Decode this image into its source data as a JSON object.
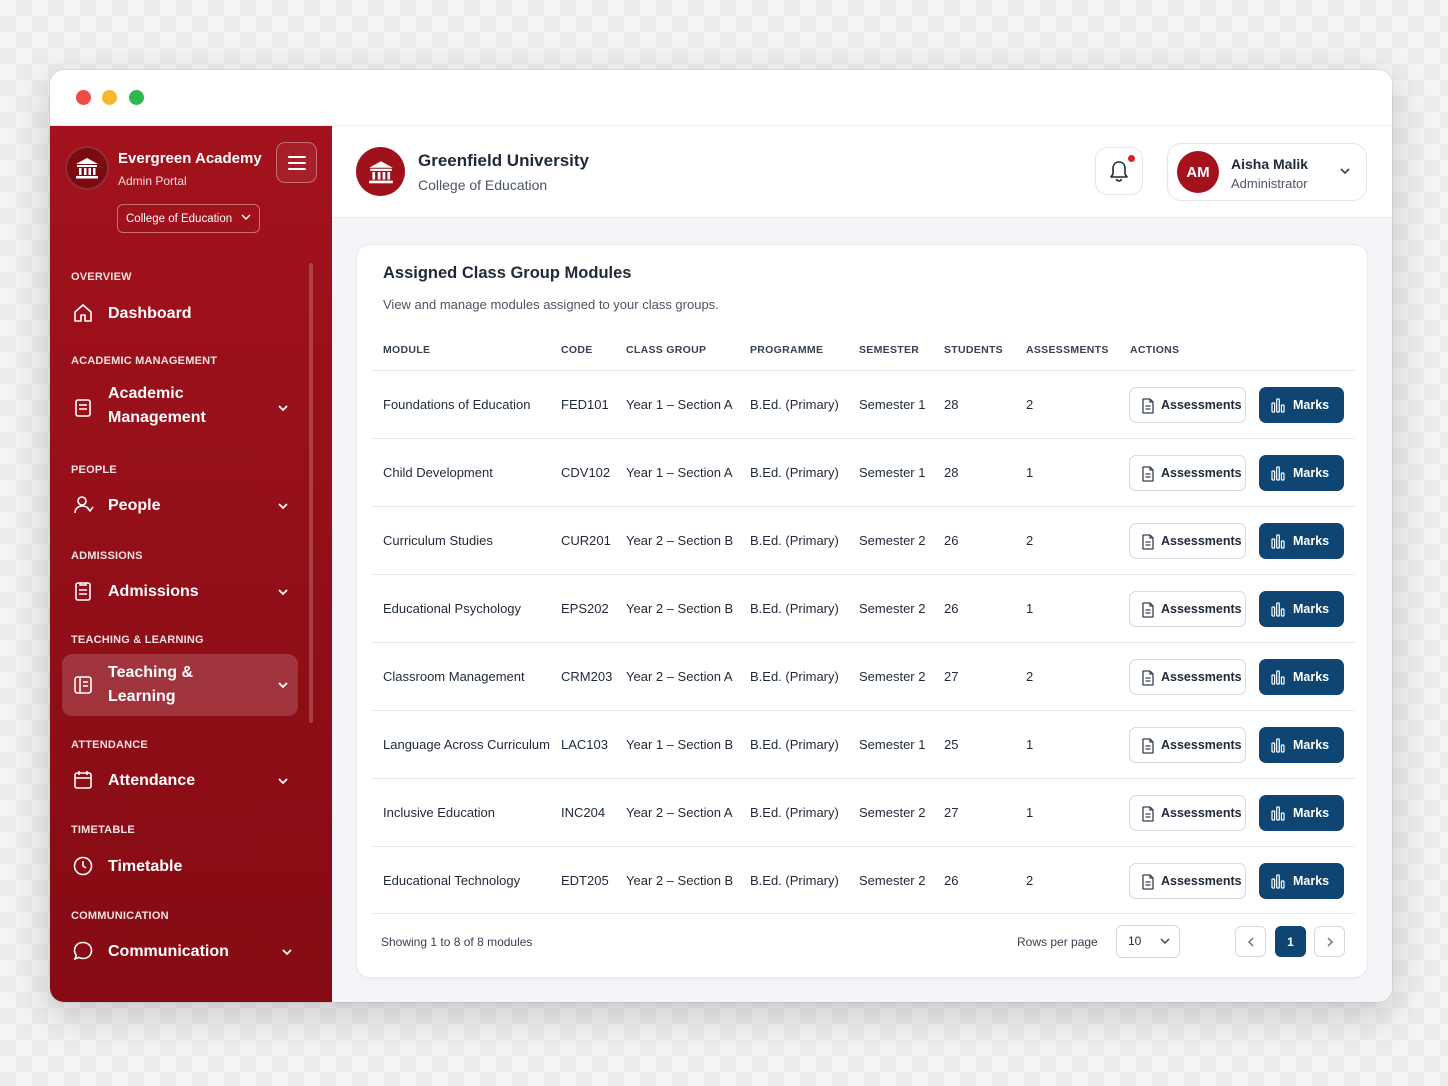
{
  "sidebar": {
    "brand_name": "Evergreen Academy",
    "brand_sub": "Admin Portal",
    "college_select": "College of Education",
    "sections": [
      {
        "heading": "OVERVIEW",
        "item": "Dashboard",
        "icon": "home-icon",
        "has_chevron": false
      },
      {
        "heading": "ACADEMIC MANAGEMENT",
        "item": "Academic Management",
        "icon": "clipboard-icon",
        "has_chevron": true
      },
      {
        "heading": "PEOPLE",
        "item": "People",
        "icon": "person-icon",
        "has_chevron": true
      },
      {
        "heading": "ADMISSIONS",
        "item": "Admissions",
        "icon": "document-icon",
        "has_chevron": true
      },
      {
        "heading": "TEACHING & LEARNING",
        "item": "Teaching & Learning",
        "icon": "book-icon",
        "has_chevron": true,
        "active": true
      },
      {
        "heading": "ATTENDANCE",
        "item": "Attendance",
        "icon": "calendar-icon",
        "has_chevron": true
      },
      {
        "heading": "TIMETABLE",
        "item": "Timetable",
        "icon": "clock-icon",
        "has_chevron": false
      },
      {
        "heading": "COMMUNICATION",
        "item": "Communication",
        "icon": "chat-icon",
        "has_chevron": true
      }
    ]
  },
  "header": {
    "university": "Greenfield University",
    "college": "College of Education",
    "user_initials": "AM",
    "user_name": "Aisha Malik",
    "user_role": "Administrator"
  },
  "card": {
    "title": "Assigned Class Group Modules",
    "subtitle": "View and manage modules assigned to your class groups.",
    "columns": [
      "MODULE",
      "CODE",
      "CLASS GROUP",
      "PROGRAMME",
      "SEMESTER",
      "STUDENTS",
      "ASSESSMENTS",
      "ACTIONS"
    ],
    "rows": [
      {
        "module": "Foundations of Education",
        "code": "FED101",
        "class_group": "Year 1 – Section A",
        "programme": "B.Ed. (Primary)",
        "semester": "Semester 1",
        "students": "28",
        "assessments": "2"
      },
      {
        "module": "Child Development",
        "code": "CDV102",
        "class_group": "Year 1 – Section A",
        "programme": "B.Ed. (Primary)",
        "semester": "Semester 1",
        "students": "28",
        "assessments": "1"
      },
      {
        "module": "Curriculum Studies",
        "code": "CUR201",
        "class_group": "Year 2 – Section B",
        "programme": "B.Ed. (Primary)",
        "semester": "Semester 2",
        "students": "26",
        "assessments": "2"
      },
      {
        "module": "Educational Psychology",
        "code": "EPS202",
        "class_group": "Year 2 – Section B",
        "programme": "B.Ed. (Primary)",
        "semester": "Semester 2",
        "students": "26",
        "assessments": "1"
      },
      {
        "module": "Classroom Management",
        "code": "CRM203",
        "class_group": "Year 2 – Section A",
        "programme": "B.Ed. (Primary)",
        "semester": "Semester 2",
        "students": "27",
        "assessments": "2"
      },
      {
        "module": "Language Across Curriculum",
        "code": "LAC103",
        "class_group": "Year 1 – Section B",
        "programme": "B.Ed. (Primary)",
        "semester": "Semester 1",
        "students": "25",
        "assessments": "1"
      },
      {
        "module": "Inclusive Education",
        "code": "INC204",
        "class_group": "Year 2 – Section A",
        "programme": "B.Ed. (Primary)",
        "semester": "Semester 2",
        "students": "27",
        "assessments": "1"
      },
      {
        "module": "Educational Technology",
        "code": "EDT205",
        "class_group": "Year 2 – Section B",
        "programme": "B.Ed. (Primary)",
        "semester": "Semester 2",
        "students": "26",
        "assessments": "2"
      }
    ],
    "assess_label": "Assessments",
    "marks_label": "Marks",
    "showing": "Showing 1 to 8 of 8 modules",
    "rows_per_page_label": "Rows per page",
    "rows_per_page": "10",
    "current_page": "1"
  },
  "colors": {
    "brand_red": "#a3121d",
    "primary_blue": "#0e4573",
    "notification": "#dc1d25"
  }
}
